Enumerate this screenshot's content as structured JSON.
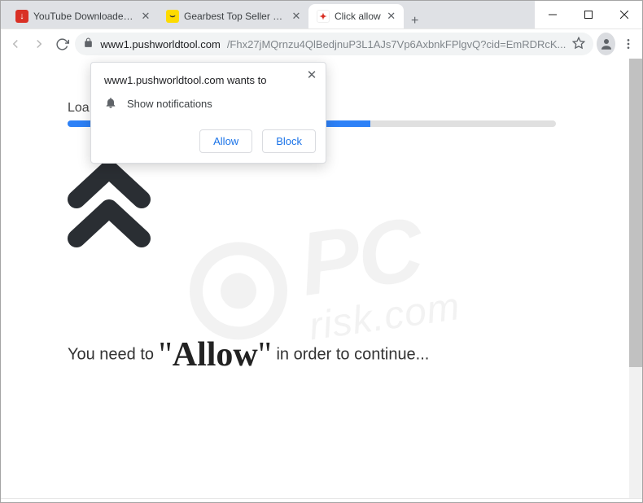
{
  "window": {
    "tabs": [
      {
        "title": "YouTube Downloader - Do",
        "fav_bg": "#d93025",
        "fav_fg": "#ffffff",
        "fav_glyph": "↓"
      },
      {
        "title": "Gearbest Top Seller - Dive",
        "fav_bg": "#fddb00",
        "fav_fg": "#333333",
        "fav_glyph": "⌣"
      },
      {
        "title": "Click allow",
        "fav_bg": "#ffffff",
        "fav_fg": "#d93025",
        "fav_glyph": "✦"
      }
    ],
    "controls": {
      "min": "—",
      "max": "▢",
      "close": "✕"
    },
    "newtab": "+"
  },
  "toolbar": {
    "url_host": "www1.pushworldtool.com",
    "url_path": "/Fhx27jMQrnzu4QlBedjnuP3L1AJs7Vp6AxbnkFPlgvQ?cid=EmRDRcK..."
  },
  "prompt": {
    "origin_text": "www1.pushworldtool.com wants to",
    "permission_label": "Show notifications",
    "allow_label": "Allow",
    "block_label": "Block",
    "close_glyph": "✕"
  },
  "page": {
    "loading_label": "Loa",
    "message_pre": "You need to ",
    "message_q1": "\"",
    "message_big": "Allow",
    "message_q2": "\"",
    "message_post": " in order to continue...",
    "progress_percent": 62
  },
  "watermark": {
    "text_main": "PC",
    "text_sub": "risk.com"
  }
}
